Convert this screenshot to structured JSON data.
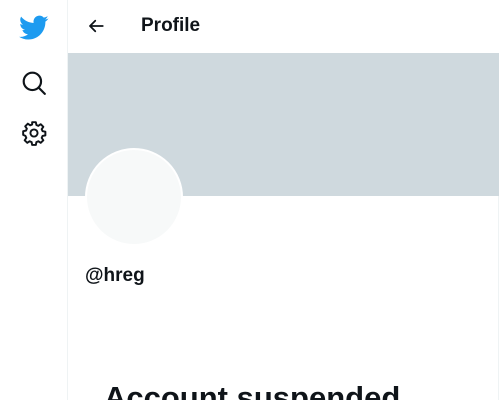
{
  "nav": {
    "logo_icon": "bird-logo-icon",
    "explore_icon": "search-icon",
    "settings_icon": "gear-icon",
    "brand_color": "#1d9bf0"
  },
  "header": {
    "title": "Profile",
    "back_icon": "arrow-left-icon"
  },
  "profile": {
    "handle": "@hreg",
    "banner_color": "#cfd9de"
  },
  "notice": {
    "title": "Account suspended"
  }
}
